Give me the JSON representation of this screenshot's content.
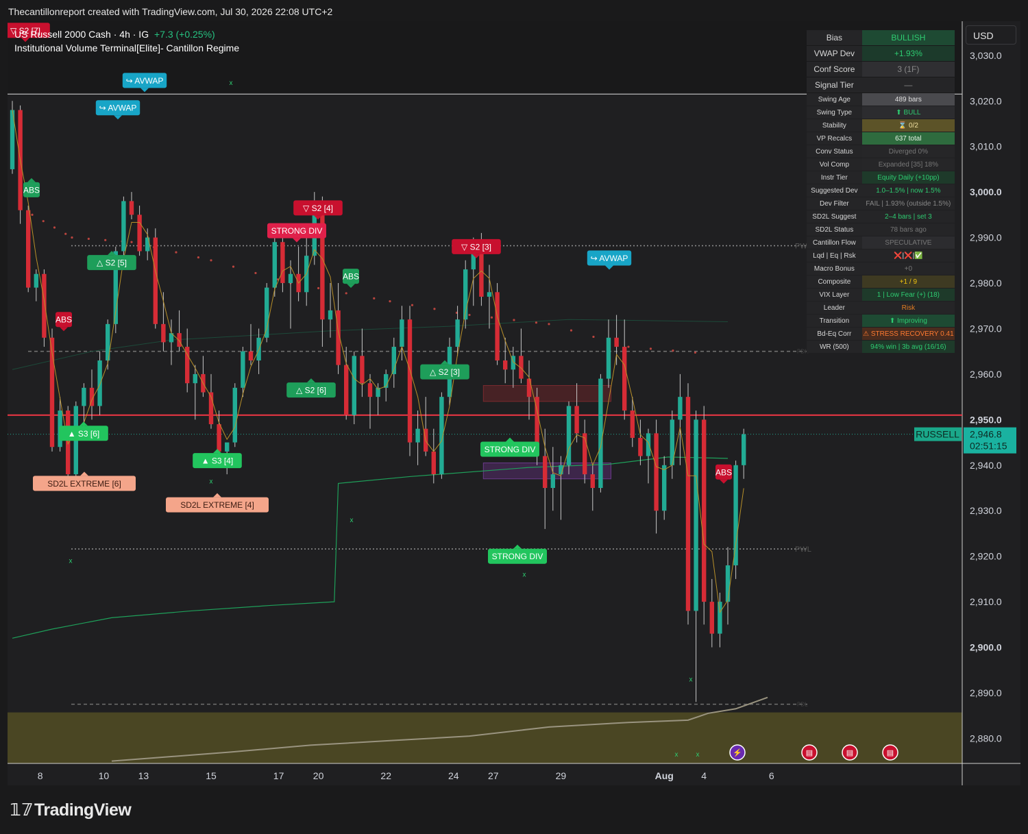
{
  "header": {
    "caption": "Thecantillonreport created with TradingView.com, Jul 30, 2026 22:08 UTC+2"
  },
  "legend": {
    "symbol": "US Russell 2000 Cash · 4h · IG",
    "change": "+7.3 (+0.25%)",
    "indicator": "Institutional Volume Terminal[Elite]- Cantillon Regime"
  },
  "currency_button": "USD",
  "price_tag": {
    "name": "RUSSELL",
    "price": "2,946.8",
    "countdown": "02:51:15"
  },
  "footer": {
    "logo_text": "TradingView"
  },
  "info_panel": [
    {
      "key": "Bias",
      "value": "BULLISH",
      "color": "#2ecc71",
      "bg": "#1e4a33",
      "big": true
    },
    {
      "key": "VWAP Dev",
      "value": "+1.93%",
      "color": "#2ecc71",
      "bg": "#1c3a2b",
      "big": true
    },
    {
      "key": "Conf Score",
      "value": "3 (1F)",
      "color": "#888888",
      "bg": "#2f2f32",
      "big": true
    },
    {
      "key": "Signal Tier",
      "value": "—",
      "color": "#888888",
      "bg": "#252527",
      "big": true
    },
    {
      "key": "Swing Age",
      "value": "489 bars",
      "color": "#e0e0e0",
      "bg": "#4a4a4e"
    },
    {
      "key": "Swing Type",
      "value": "⬆ BULL",
      "color": "#2ecc71",
      "bg": "#2c2c2f"
    },
    {
      "key": "Stability",
      "value": "⌛ 0/2",
      "color": "#f0e0a0",
      "bg": "#5c5328"
    },
    {
      "key": "VP Recalcs",
      "value": "637 total",
      "color": "#e8f5e8",
      "bg": "#2e6b3e"
    },
    {
      "key": "Conv Status",
      "value": "Diverged 0%",
      "color": "#777777",
      "bg": "#262628"
    },
    {
      "key": "Vol Comp",
      "value": "Expanded [35] 18%",
      "color": "#777777",
      "bg": "#262628"
    },
    {
      "key": "Instr Tier",
      "value": "Equity Daily (+10pp)",
      "color": "#2ecc71",
      "bg": "#1e3a2a"
    },
    {
      "key": "Suggested Dev",
      "value": "1.0–1.5% | now 1.5%",
      "color": "#2ecc71",
      "bg": "#252527"
    },
    {
      "key": "Dev Filter",
      "value": "FAIL | 1.93% (outside 1.5%)",
      "color": "#888888",
      "bg": "#252527"
    },
    {
      "key": "SD2L Suggest",
      "value": "2–4 bars | set 3",
      "color": "#2ecc71",
      "bg": "#252527"
    },
    {
      "key": "SD2L Status",
      "value": "78 bars ago",
      "color": "#777777",
      "bg": "#252527"
    },
    {
      "key": "Cantillon Flow",
      "value": "SPECULATIVE",
      "color": "#777777",
      "bg": "#2c2c2f"
    },
    {
      "key": "Lqd | Eq | Rsk",
      "value": "❌|❌|✅",
      "color": "#e0e0e0",
      "bg": "#252527"
    },
    {
      "key": "Macro Bonus",
      "value": "+0",
      "color": "#777777",
      "bg": "#252527"
    },
    {
      "key": "Composite",
      "value": "+1 / 9",
      "color": "#f1c40f",
      "bg": "#3e3a22"
    },
    {
      "key": "VIX Layer",
      "value": "1 | Low Fear (+) (18)",
      "color": "#2ecc71",
      "bg": "#1e3a2a"
    },
    {
      "key": "Leader",
      "value": "Risk",
      "color": "#e67e22",
      "bg": "#252527"
    },
    {
      "key": "Transition",
      "value": "⬆ Improving",
      "color": "#2ecc71",
      "bg": "#1e4a33"
    },
    {
      "key": "Bd-Eq Corr",
      "value": "⚠ STRESS RECOVERY 0.41",
      "color": "#ff7a30",
      "bg": "#4a2c1e"
    },
    {
      "key": "WR (500)",
      "value": "94% win | 3b avg (16/16)",
      "color": "#2ecc71",
      "bg": "#1e3a2a"
    }
  ],
  "chart_data": {
    "type": "candlestick",
    "interval": "4h",
    "y_ticks": [
      "3,030.0",
      "3,020.0",
      "3,010.0",
      "3,000.0",
      "2,990.0",
      "2,980.0",
      "2,970.0",
      "2,960.0",
      "2,950.0",
      "2,940.0",
      "2,930.0",
      "2,920.0",
      "2,910.0",
      "2,900.0",
      "2,890.0",
      "2,880.0"
    ],
    "y_tick_values": [
      3030,
      3020,
      3010,
      3000,
      2990,
      2980,
      2970,
      2960,
      2950,
      2940,
      2930,
      2920,
      2910,
      2900,
      2890,
      2880
    ],
    "ylim": [
      2874.5,
      3037.5
    ],
    "x_ticks": [
      {
        "label": "8",
        "bar": 7
      },
      {
        "label": "10",
        "bar": 23
      },
      {
        "label": "13",
        "bar": 33
      },
      {
        "label": "15",
        "bar": 50
      },
      {
        "label": "17",
        "bar": 67
      },
      {
        "label": "20",
        "bar": 77
      },
      {
        "label": "22",
        "bar": 94
      },
      {
        "label": "24",
        "bar": 111
      },
      {
        "label": "27",
        "bar": 121
      },
      {
        "label": "29",
        "bar": 138
      },
      {
        "label": "Aug",
        "bar": 164
      },
      {
        "label": "4",
        "bar": 174
      },
      {
        "label": "6",
        "bar": 191
      }
    ],
    "candles": [
      [
        3005,
        3020,
        3004,
        3018
      ],
      [
        3018,
        3019,
        2993,
        2996
      ],
      [
        2996,
        2997,
        2978,
        2979
      ],
      [
        2979,
        2983,
        2976,
        2982
      ],
      [
        2982,
        2983,
        2966,
        2968
      ],
      [
        2968,
        2970,
        2943,
        2944
      ],
      [
        2944,
        2955,
        2943,
        2952
      ],
      [
        2952,
        2953,
        2937,
        2938
      ],
      [
        2938,
        2954,
        2937,
        2953
      ],
      [
        2953,
        2958,
        2948,
        2957
      ],
      [
        2957,
        2961,
        2950,
        2953
      ],
      [
        2953,
        2965,
        2951,
        2963
      ],
      [
        2963,
        2972,
        2961,
        2971
      ],
      [
        2971,
        2988,
        2969,
        2987
      ],
      [
        2987,
        2999,
        2985,
        2998
      ],
      [
        2998,
        3000,
        2994,
        2995
      ],
      [
        2995,
        2997,
        2986,
        2987
      ],
      [
        2987,
        2992,
        2985,
        2990
      ],
      [
        2990,
        2992,
        2970,
        2971
      ],
      [
        2971,
        2978,
        2965,
        2967
      ],
      [
        2967,
        2972,
        2962,
        2969
      ],
      [
        2969,
        2974,
        2965,
        2966
      ],
      [
        2966,
        2970,
        2956,
        2958
      ],
      [
        2958,
        2962,
        2950,
        2960
      ],
      [
        2960,
        2964,
        2955,
        2956
      ],
      [
        2956,
        2960,
        2948,
        2949
      ],
      [
        2949,
        2952,
        2940,
        2943
      ],
      [
        2943,
        2944,
        2938,
        2945
      ],
      [
        2945,
        2958,
        2944,
        2957
      ],
      [
        2957,
        2966,
        2955,
        2965
      ],
      [
        2965,
        2971,
        2962,
        2963
      ],
      [
        2963,
        2970,
        2960,
        2968
      ],
      [
        2968,
        2980,
        2967,
        2979
      ],
      [
        2979,
        2990,
        2977,
        2989
      ],
      [
        2989,
        2992,
        2978,
        2980
      ],
      [
        2980,
        2985,
        2970,
        2982
      ],
      [
        2982,
        2988,
        2976,
        2978
      ],
      [
        2978,
        2990,
        2975,
        2986
      ],
      [
        2986,
        3000,
        2984,
        2998
      ],
      [
        2998,
        2999,
        2966,
        2972
      ],
      [
        2972,
        2980,
        2968,
        2974
      ],
      [
        2974,
        2980,
        2960,
        2962
      ],
      [
        2962,
        2966,
        2950,
        2951
      ],
      [
        2951,
        2965,
        2949,
        2964
      ],
      [
        2964,
        2970,
        2955,
        2958
      ],
      [
        2958,
        2960,
        2948,
        2955
      ],
      [
        2955,
        2958,
        2951,
        2957
      ],
      [
        2957,
        2961,
        2954,
        2960
      ],
      [
        2960,
        2968,
        2957,
        2966
      ],
      [
        2966,
        2975,
        2963,
        2972
      ],
      [
        2972,
        2975,
        2942,
        2945
      ],
      [
        2945,
        2952,
        2940,
        2948
      ],
      [
        2948,
        2955,
        2942,
        2943
      ],
      [
        2943,
        2948,
        2936,
        2938
      ],
      [
        2938,
        2956,
        2937,
        2955
      ],
      [
        2955,
        2968,
        2953,
        2966
      ],
      [
        2966,
        2975,
        2964,
        2972
      ],
      [
        2972,
        2985,
        2970,
        2983
      ],
      [
        2983,
        2990,
        2975,
        2988
      ],
      [
        2988,
        2991,
        2975,
        2977
      ],
      [
        2977,
        2984,
        2970,
        2978
      ],
      [
        2978,
        2980,
        2962,
        2963
      ],
      [
        2963,
        2968,
        2958,
        2961
      ],
      [
        2961,
        2966,
        2957,
        2964
      ],
      [
        2964,
        2970,
        2958,
        2959
      ],
      [
        2959,
        2963,
        2950,
        2955
      ],
      [
        2955,
        2957,
        2940,
        2942
      ],
      [
        2942,
        2948,
        2926,
        2935
      ],
      [
        2935,
        2944,
        2930,
        2938
      ],
      [
        2938,
        2942,
        2928,
        2940
      ],
      [
        2940,
        2954,
        2938,
        2953
      ],
      [
        2953,
        2958,
        2945,
        2947
      ],
      [
        2947,
        2950,
        2936,
        2938
      ],
      [
        2938,
        2940,
        2930,
        2935
      ],
      [
        2935,
        2960,
        2934,
        2959
      ],
      [
        2959,
        2972,
        2957,
        2968
      ],
      [
        2968,
        2973,
        2962,
        2966
      ],
      [
        2966,
        2972,
        2950,
        2952
      ],
      [
        2952,
        2955,
        2944,
        2946
      ],
      [
        2946,
        2950,
        2940,
        2942
      ],
      [
        2942,
        2948,
        2936,
        2947
      ],
      [
        2947,
        2950,
        2925,
        2930
      ],
      [
        2930,
        2942,
        2928,
        2940
      ],
      [
        2940,
        2952,
        2937,
        2950
      ],
      [
        2950,
        2960,
        2940,
        2955
      ],
      [
        2955,
        2958,
        2905,
        2908
      ],
      [
        2908,
        2952,
        2888,
        2950
      ],
      [
        2950,
        2953,
        2905,
        2910
      ],
      [
        2910,
        2915,
        2900,
        2903
      ],
      [
        2903,
        2912,
        2900,
        2910
      ],
      [
        2910,
        2922,
        2905,
        2918
      ],
      [
        2918,
        2941,
        2915,
        2940
      ],
      [
        2940,
        2948,
        2937,
        2946.8
      ]
    ]
  },
  "annotations": {
    "s2_7": "▽ S2 [7]",
    "avwap": "↪ AVWAP",
    "s2_5": "△ S2 [5]",
    "abs": "ABS",
    "s2_4": "▽ S2 [4]",
    "strong": "STRONG DIV",
    "s2_6": "△ S2 [6]",
    "s3_6": "▲ S3 [6]",
    "s3_4": "▲ S3 [4]",
    "sd2l_6": "SD2L EXTREME [6]",
    "sd2l_4": "SD2L EXTREME [4]",
    "s2_3_down": "▽ S2 [3]",
    "s2_3_up": "△ S2 [3]",
    "strong_div": "STRONG DIV",
    "pwh": "PWH",
    "pwl": "PWL",
    "pdh": "PDH",
    "pdl": "PDL",
    "x_mark": "x"
  },
  "colors": {
    "up": "#22ab94",
    "down": "#d62c36",
    "red_line": "#f23645",
    "label_red": "#c8102e",
    "label_cyan": "#18a5c7",
    "label_green": "#1e9e5a",
    "label_salmon": "#f4a58a",
    "zone_band": "#4a4623"
  }
}
